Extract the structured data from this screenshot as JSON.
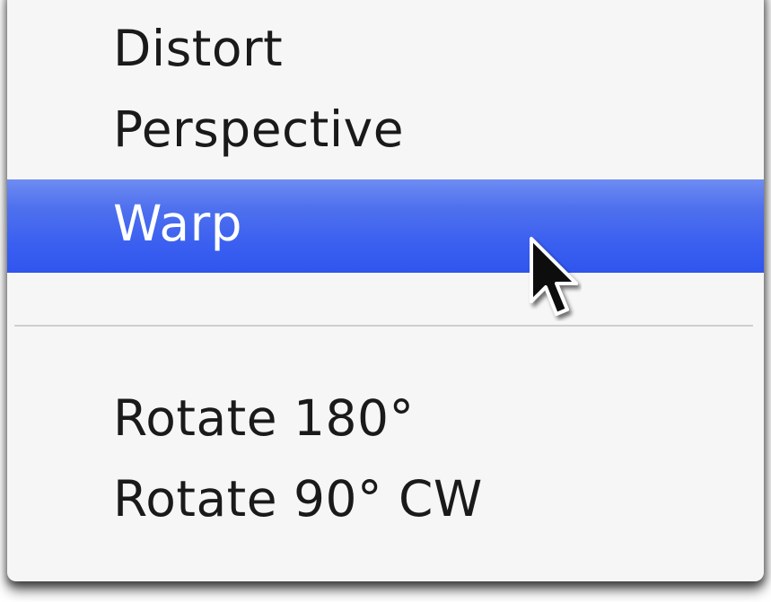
{
  "menu": {
    "items": [
      {
        "label": "Distort"
      },
      {
        "label": "Perspective"
      },
      {
        "label": "Warp",
        "highlighted": true
      },
      {
        "label": "Rotate 180°"
      },
      {
        "label": "Rotate 90° CW"
      }
    ]
  },
  "colors": {
    "highlight": "#3a5ff0",
    "menu_background": "#f6f6f6",
    "text": "#1a1a1a"
  },
  "cursor": {
    "icon": "arrow-pointer-icon"
  }
}
